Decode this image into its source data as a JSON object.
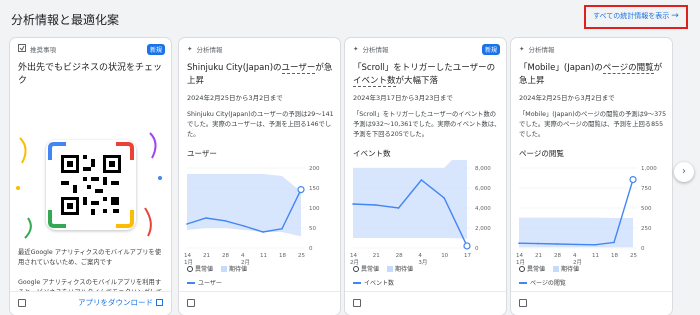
{
  "header": {
    "title": "分析情報と最適化案",
    "view_all": "すべての統計情報を表示",
    "view_all_arrow": "→"
  },
  "nav": {
    "next_icon": "›"
  },
  "cards": [
    {
      "type": "recommendation",
      "category": "推奨事項",
      "badge": "新規",
      "title": "外出先でもビジネスの状況をチェック",
      "text1": "最近Google アナリティクスのモバイルアプリを使用されていないため、ご案内です",
      "text2": "Google アナリティクスのモバイルアプリを利用すると、ビジネスをリアルタイムでモニタリングしてレポートを作成し、アカウントの改善案を確認できます",
      "footer_link": "アプリをダウンロード"
    },
    {
      "category": "分析情報",
      "badge": "",
      "title_pre": "Shinjuku City(Japan)の",
      "title_metric": "ユーザー",
      "title_post": "が急上昇",
      "date": "2024年2月25日から3月2日まで",
      "desc": "Shinjuku City(Japan)のユーザーの予測は29～141でした。実際のユーザーは、予測を上回る146でした。",
      "metric_label": "ユーザー",
      "legend_anomaly": "異常値",
      "legend_expected": "期待値",
      "series_label": "ユーザー"
    },
    {
      "category": "分析情報",
      "badge": "新規",
      "title_pre": "「Scroll」をトリガーしたユーザーの",
      "title_metric": "イベント数",
      "title_post": "が大幅下落",
      "date": "2024年3月17日から3月23日まで",
      "desc": "「Scroll」をトリガーしたユーザーのイベント数の予測は932～10,361でした。実際のイベント数は、予測を下回る205でした。",
      "metric_label": "イベント数",
      "legend_anomaly": "異常値",
      "legend_expected": "期待値",
      "series_label": "イベント数"
    },
    {
      "category": "分析情報",
      "badge": "",
      "title_pre": "「Mobile」(Japan)の",
      "title_metric": "ページの閲覧",
      "title_post": "が急上昇",
      "date": "2024年2月25日から3月2日まで",
      "desc": "「Mobile」(Japan)のページの閲覧の予測は9～375でした。実際のページの閲覧は、予測を上回る855でした。",
      "metric_label": "ページの閲覧",
      "legend_anomaly": "異常値",
      "legend_expected": "期待値",
      "series_label": "ページの閲覧"
    }
  ],
  "chart_data": [
    {
      "type": "line",
      "x": [
        "14",
        "21",
        "28",
        "4",
        "11",
        "18",
        "25"
      ],
      "x_sub": [
        "1月",
        "",
        "",
        "2月",
        "",
        "",
        ""
      ],
      "values": [
        60,
        75,
        68,
        55,
        40,
        48,
        146
      ],
      "expected_band": [
        [
          45,
          185
        ],
        [
          50,
          185
        ],
        [
          50,
          185
        ],
        [
          45,
          185
        ],
        [
          40,
          185
        ],
        [
          40,
          180
        ],
        [
          29,
          141
        ]
      ],
      "ylim": [
        0,
        200
      ],
      "yticks": [
        "0",
        "50",
        "100",
        "150",
        "200"
      ]
    },
    {
      "type": "line",
      "x": [
        "14",
        "21",
        "28",
        "4",
        "10",
        "17"
      ],
      "x_sub": [
        "",
        "",
        "",
        "3月",
        "",
        ""
      ],
      "x_sub_first": "2月",
      "values": [
        4400,
        4300,
        4000,
        6800,
        5000,
        205
      ],
      "expected_band": [
        [
          1000,
          8000
        ],
        [
          1000,
          8000
        ],
        [
          1000,
          8000
        ],
        [
          1000,
          8000
        ],
        [
          1000,
          8000
        ],
        [
          932,
          10361
        ]
      ],
      "ylim": [
        0,
        8000
      ],
      "yticks": [
        "0",
        "2,000",
        "4,000",
        "6,000",
        "8,000"
      ]
    },
    {
      "type": "line",
      "x": [
        "14",
        "21",
        "28",
        "4",
        "11",
        "18",
        "25"
      ],
      "x_sub": [
        "1月",
        "",
        "",
        "2月",
        "",
        "",
        ""
      ],
      "values": [
        60,
        55,
        50,
        45,
        40,
        70,
        855
      ],
      "expected_band": [
        [
          9,
          380
        ],
        [
          9,
          380
        ],
        [
          9,
          380
        ],
        [
          9,
          380
        ],
        [
          9,
          380
        ],
        [
          9,
          375
        ],
        [
          9,
          375
        ]
      ],
      "ylim": [
        0,
        1000
      ],
      "yticks": [
        "0",
        "250",
        "500",
        "750",
        "1,000"
      ]
    }
  ],
  "colors": {
    "accent": "#1a73e8",
    "line": "#4285f4",
    "band": "#c6dafc",
    "highlight": "#e0201f"
  }
}
